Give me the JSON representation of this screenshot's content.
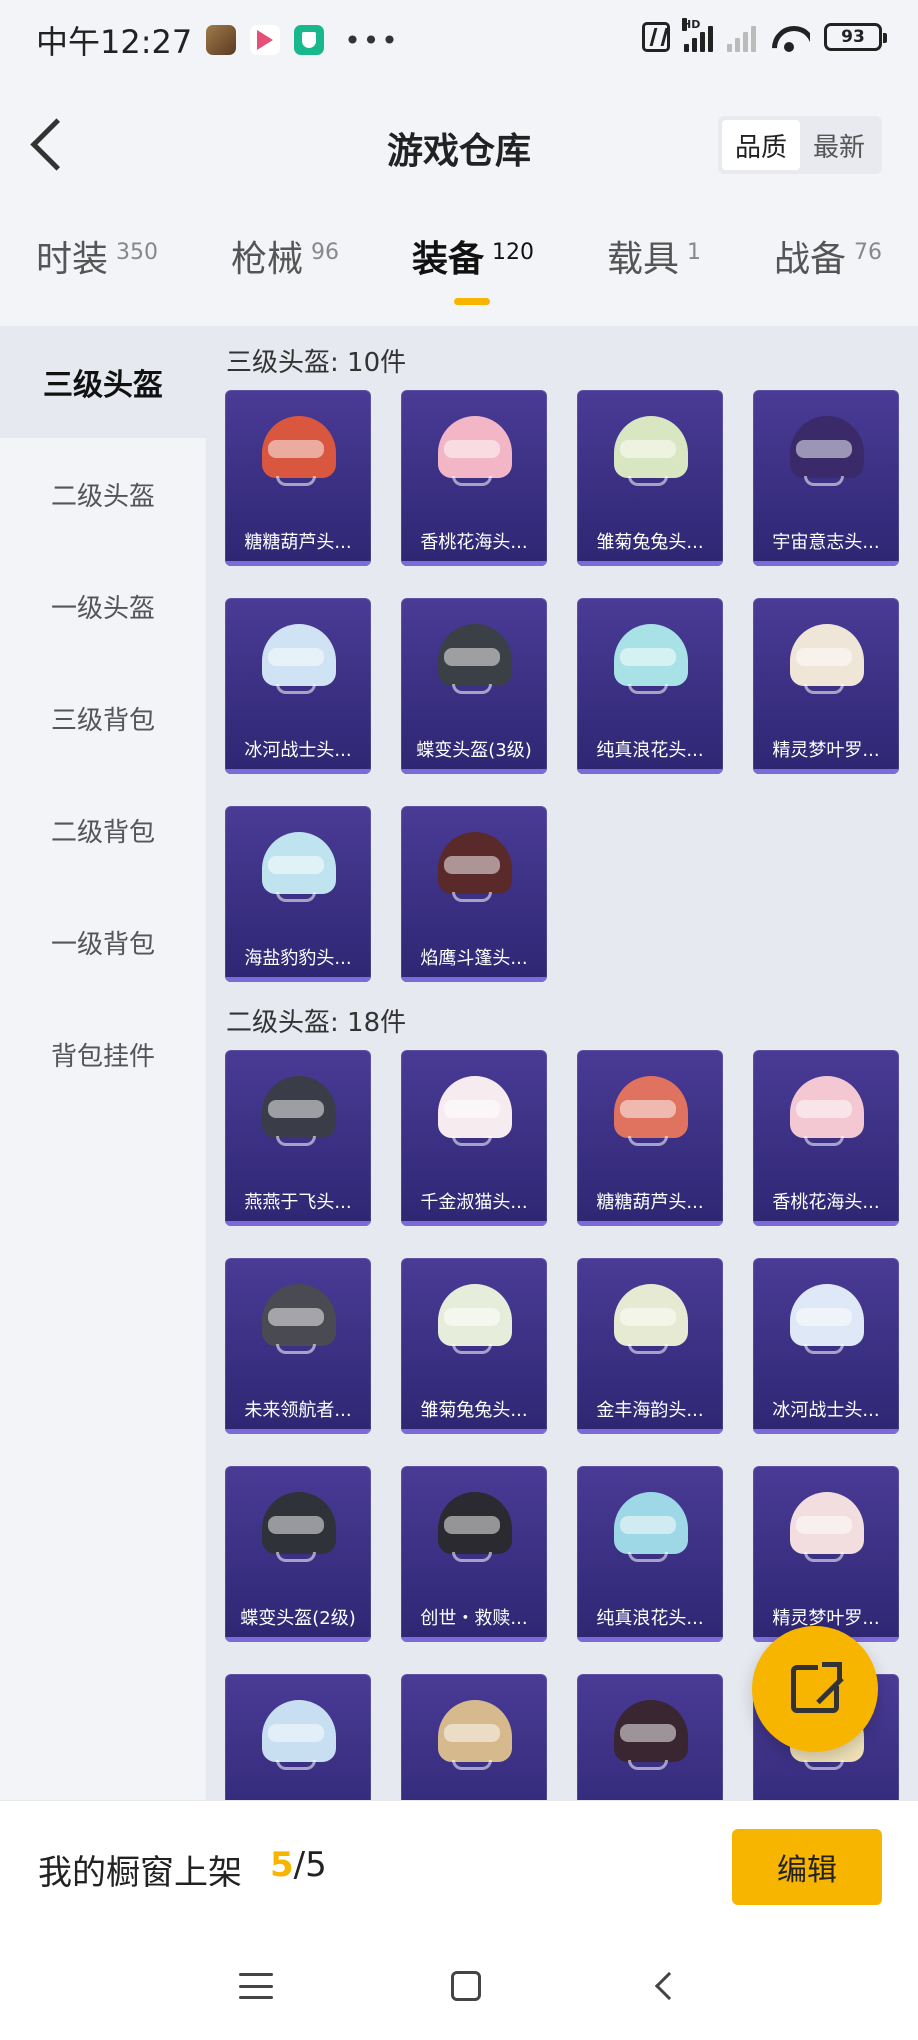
{
  "status_bar": {
    "time": "中午12:27",
    "battery": "93",
    "signal_tag": "HD"
  },
  "header": {
    "title": "游戏仓库",
    "sort_options": [
      "品质",
      "最新"
    ],
    "sort_active": "品质"
  },
  "tabs": [
    {
      "label": "时装",
      "count": "350"
    },
    {
      "label": "枪械",
      "count": "96"
    },
    {
      "label": "装备",
      "count": "120"
    },
    {
      "label": "载具",
      "count": "1"
    },
    {
      "label": "战备",
      "count": "76"
    }
  ],
  "active_tab": "装备",
  "sidebar": {
    "items": [
      "三级头盔",
      "二级头盔",
      "一级头盔",
      "三级背包",
      "二级背包",
      "一级背包",
      "背包挂件"
    ],
    "active": "三级头盔"
  },
  "sections": [
    {
      "title": "三级头盔: 10件",
      "items": [
        {
          "name": "糖糖葫芦头...",
          "color": "#d9573f"
        },
        {
          "name": "香桃花海头...",
          "color": "#f2b6c6"
        },
        {
          "name": "雏菊兔兔头...",
          "color": "#d8e6c2"
        },
        {
          "name": "宇宙意志头...",
          "color": "#3a2a6a"
        },
        {
          "name": "冰河战士头...",
          "color": "#cfe3f4"
        },
        {
          "name": "蝶变头盔(3级)",
          "color": "#3b3f46"
        },
        {
          "name": "纯真浪花头...",
          "color": "#a9e2e6"
        },
        {
          "name": "精灵梦叶罗...",
          "color": "#efe6d8"
        },
        {
          "name": "海盐豹豹头...",
          "color": "#bfe4ef"
        },
        {
          "name": "焰鹰斗篷头...",
          "color": "#5a2a2a"
        }
      ]
    },
    {
      "title": "二级头盔: 18件",
      "items": [
        {
          "name": "燕燕于飞头...",
          "color": "#3a3d48"
        },
        {
          "name": "千金淑猫头...",
          "color": "#f6ecef"
        },
        {
          "name": "糖糖葫芦头...",
          "color": "#e0735f"
        },
        {
          "name": "香桃花海头...",
          "color": "#f3c8d2"
        },
        {
          "name": "未来领航者...",
          "color": "#4a4a52"
        },
        {
          "name": "雏菊兔兔头...",
          "color": "#e6eedb"
        },
        {
          "name": "金丰海韵头...",
          "color": "#e7ead2"
        },
        {
          "name": "冰河战士头...",
          "color": "#dfe8f6"
        },
        {
          "name": "蝶变头盔(2级)",
          "color": "#2f3238"
        },
        {
          "name": "创世・救赎...",
          "color": "#2a2a30"
        },
        {
          "name": "纯真浪花头...",
          "color": "#9ed8e6"
        },
        {
          "name": "精灵梦叶罗...",
          "color": "#f2dede"
        },
        {
          "name": "",
          "color": "#c7dff0"
        },
        {
          "name": "",
          "color": "#d6b98c"
        },
        {
          "name": "",
          "color": "#3a2630"
        },
        {
          "name": "",
          "color": "#efe0b6"
        }
      ]
    }
  ],
  "bottom_bar": {
    "label": "我的橱窗上架",
    "current": "5",
    "separator": "/",
    "total": "5",
    "edit_label": "编辑"
  },
  "icons": {
    "back": "back-arrow-icon",
    "share": "share-external-icon",
    "nav": [
      "menu-icon",
      "home-icon",
      "back-icon"
    ]
  }
}
